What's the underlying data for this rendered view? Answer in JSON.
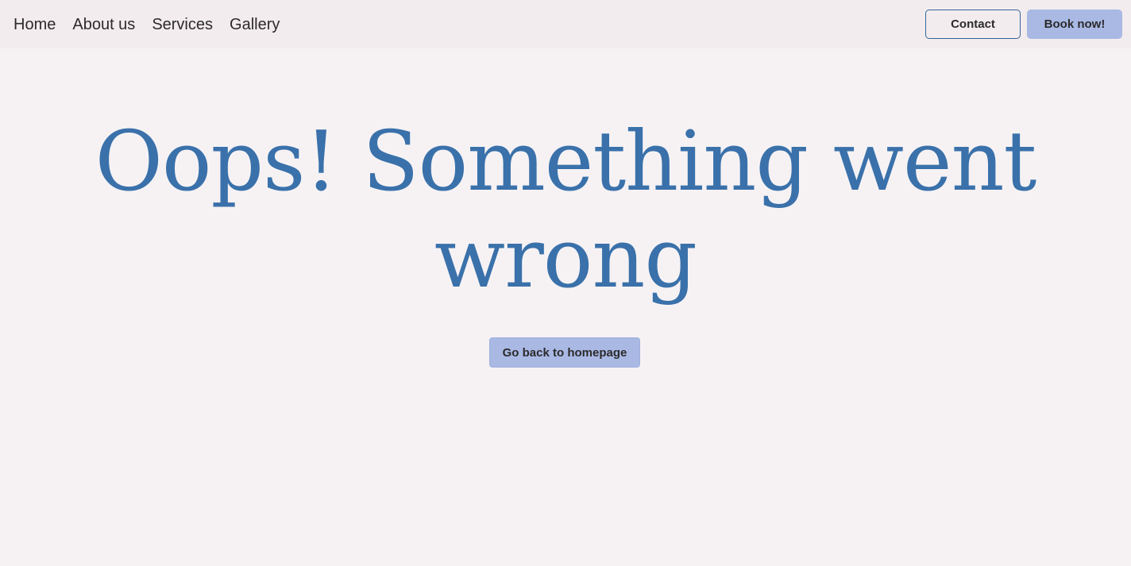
{
  "nav": {
    "links": [
      "Home",
      "About us",
      "Services",
      "Gallery"
    ],
    "contact_label": "Contact",
    "book_label": "Book now!"
  },
  "main": {
    "heading": "Oops! Something went wrong",
    "home_button_label": "Go back to homepage"
  },
  "colors": {
    "background": "#f6f2f4",
    "navbar": "#f2ecee",
    "heading": "#3a71aa",
    "accent_button": "#a9b9e4",
    "outline": "#35649a"
  }
}
